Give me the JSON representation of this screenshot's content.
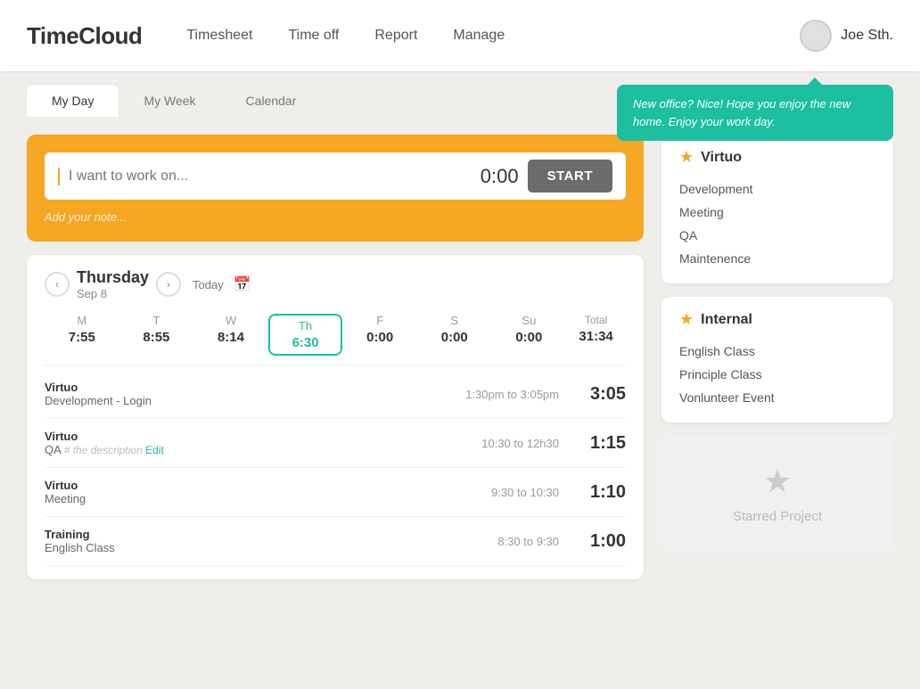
{
  "header": {
    "logo": "TimeCloud",
    "nav": [
      {
        "label": "Timesheet",
        "id": "timesheet"
      },
      {
        "label": "Time off",
        "id": "timeoff"
      },
      {
        "label": "Report",
        "id": "report"
      },
      {
        "label": "Manage",
        "id": "manage"
      }
    ],
    "user": "Joe Sth."
  },
  "tabs": [
    {
      "label": "My Day",
      "id": "my-day",
      "active": true
    },
    {
      "label": "My Week",
      "id": "my-week"
    },
    {
      "label": "Calendar",
      "id": "calendar"
    }
  ],
  "notification": {
    "message": "New office? Nice! Hope you enjoy the new home. Enjoy your work day."
  },
  "timer": {
    "placeholder": "I want to work on...",
    "time": "0:00",
    "start_label": "START",
    "note_placeholder": "Add your note..."
  },
  "timesheet": {
    "day": "Thursday",
    "date": "Sep 8",
    "today_label": "Today",
    "week_days": [
      {
        "short": "M",
        "hours": "7:55"
      },
      {
        "short": "T",
        "hours": "8:55"
      },
      {
        "short": "W",
        "hours": "8:14"
      },
      {
        "short": "Th",
        "hours": "6:30",
        "active": true
      },
      {
        "short": "F",
        "hours": "0:00"
      },
      {
        "short": "S",
        "hours": "0:00"
      },
      {
        "short": "Su",
        "hours": "0:00"
      }
    ],
    "total": "31:34",
    "entries": [
      {
        "project": "Virtuo",
        "task": "Development - Login",
        "time_range": "1:30pm to 3:05pm",
        "duration": "3:05"
      },
      {
        "project": "Virtuo",
        "task": "QA",
        "task_hint": "# the description",
        "task_edit": "Edit",
        "time_range": "10:30 to 12h30",
        "duration": "1:15"
      },
      {
        "project": "Virtuo",
        "task": "Meeting",
        "time_range": "9:30 to 10:30",
        "duration": "1:10"
      },
      {
        "project": "Training",
        "task": "English Class",
        "time_range": "8:30 to 9:30",
        "duration": "1:00"
      }
    ]
  },
  "projects": [
    {
      "name": "Virtuo",
      "items": [
        "Development",
        "Meeting",
        "QA",
        "Maintenence"
      ]
    },
    {
      "name": "Internal",
      "items": [
        "English Class",
        "Principle Class",
        "Vonlunteer Event"
      ]
    }
  ],
  "starred_placeholder": {
    "label": "Starred Project"
  }
}
